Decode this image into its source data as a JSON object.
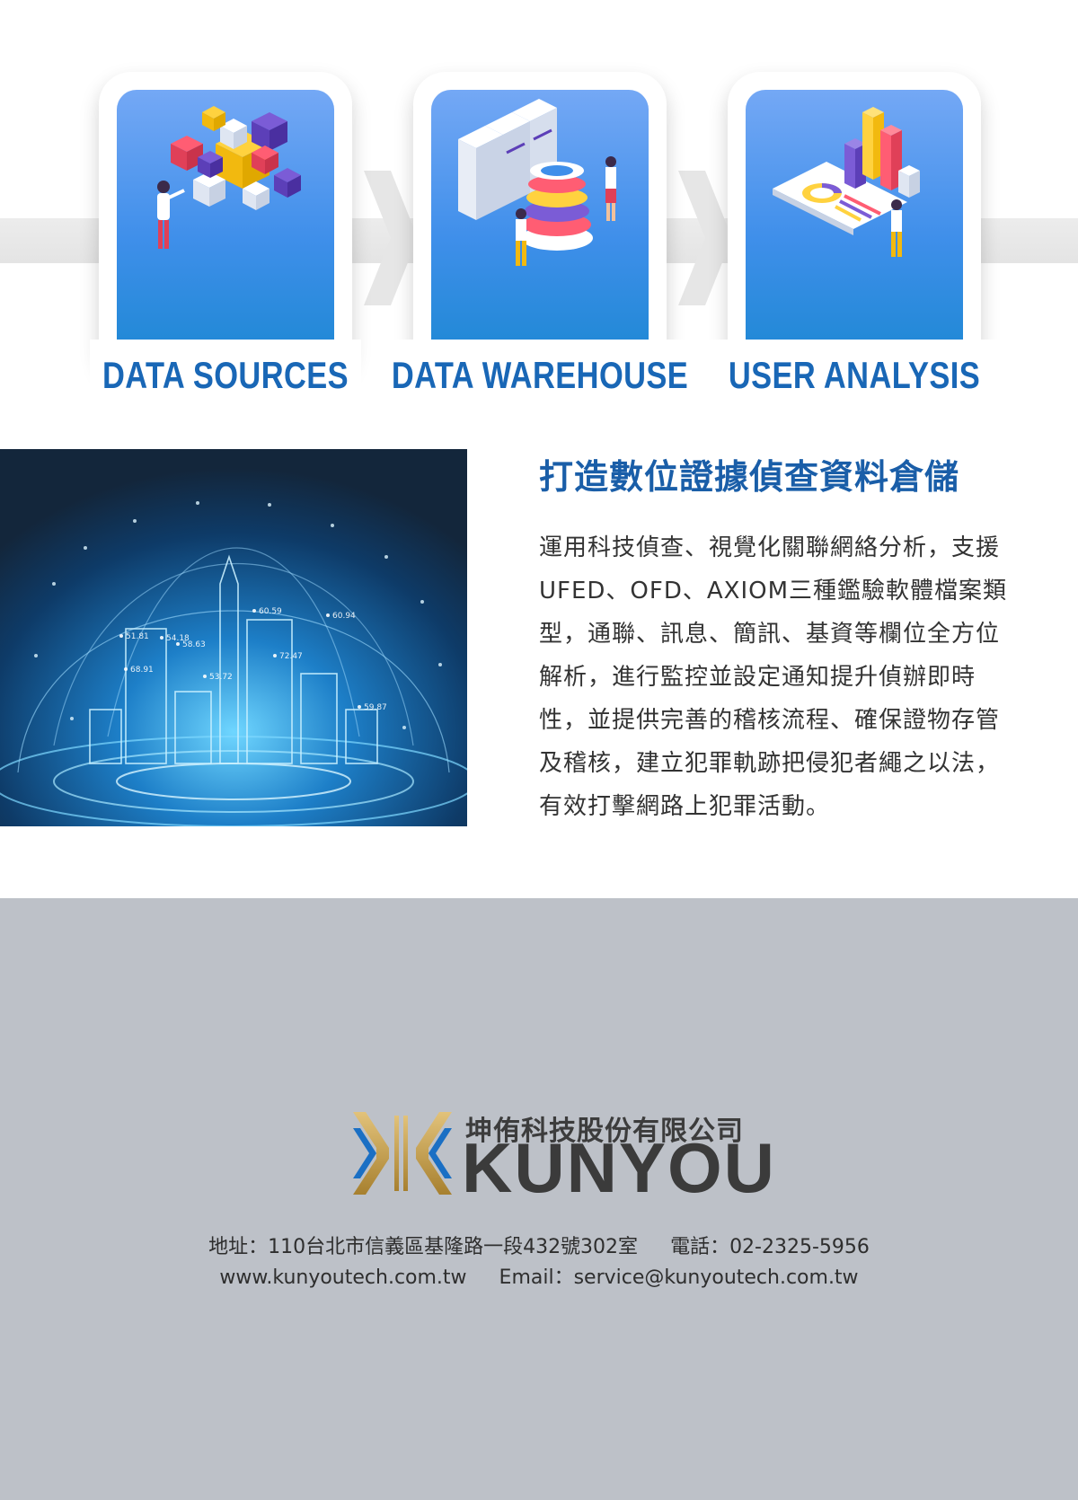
{
  "process": {
    "steps": [
      {
        "label": "DATA SOURCES",
        "icon": "cubes-illustration"
      },
      {
        "label": "DATA WAREHOUSE",
        "icon": "server-database-illustration"
      },
      {
        "label": "USER ANALYSIS",
        "icon": "phone-chart-illustration"
      }
    ]
  },
  "city_image": {
    "labels": [
      "51.81",
      "54.18",
      "58.63",
      "60.59",
      "60.94",
      "68.91",
      "72.47",
      "53.72",
      "59.87"
    ]
  },
  "feature": {
    "heading": "打造數位證據偵查資料倉儲",
    "body": "運用科技偵查、視覺化關聯網絡分析，支援UFED、OFD、AXIOM三種鑑驗軟體檔案類型，通聯、訊息、簡訊、基資等欄位全方位解析，進行監控並設定通知提升偵辦即時性，並提供完善的稽核流程、確保證物存管及稽核，建立犯罪軌跡把侵犯者繩之以法，有效打擊網路上犯罪活動。"
  },
  "footer": {
    "company_cn": "坤侑科技股份有限公司",
    "company_en": "KUNYOU",
    "address": "地址：110台北市信義區基隆路一段432號302室",
    "phone": "電話：02-2325-5956",
    "website": "www.kunyoutech.com.tw",
    "email": "Email：service@kunyoutech.com.tw"
  },
  "colors": {
    "accent": "#1967b6",
    "heading": "#1a5ea8",
    "footer_bg": "#bdc1c8",
    "logo_gold": "#c9a24a",
    "logo_blue": "#1a6fc4"
  }
}
